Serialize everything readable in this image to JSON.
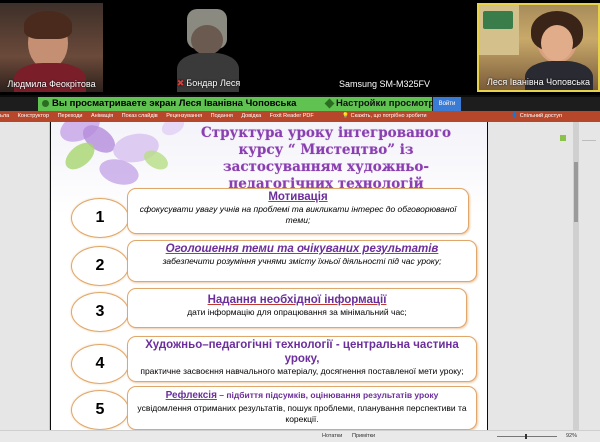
{
  "participants": [
    {
      "name": "Людмила Феокрітова"
    },
    {
      "name": "Бондар Леся",
      "muted": true
    },
    {
      "name": "Samsung SM-M325FV"
    },
    {
      "name": "Леся Іванівна Чоповська"
    }
  ],
  "share": {
    "banner": "Вы просматриваете экран Леся Іванівна Чоповська",
    "settings": "Настройки просмотра",
    "enter_label": "Войти"
  },
  "ribbon": {
    "tabs": [
      "ьла",
      "Конструктор",
      "Переходи",
      "Анімація",
      "Показ слайдів",
      "Рецензування",
      "Подання",
      "Довідка",
      "Foxit Reader PDF"
    ],
    "tell": "Скажіть, що потрібно зробити",
    "share": "Спільний доступ"
  },
  "slide": {
    "title": "Структура уроку інтегрованого курсу  “ Мистецтво” із застосуванням художньо-педагогічних технологій",
    "steps": [
      {
        "num": "1",
        "head": "Мотивація",
        "body": "сфокусувати увагу учнів на проблемі та викликати інтерес до обговорюваної теми;"
      },
      {
        "num": "2",
        "head": "Оголошення теми та очікуваних результатів",
        "body": "забезпечити розуміння учнями змісту їхньої діяльності під час уроку;"
      },
      {
        "num": "3",
        "head": "Надання необхідної інформації",
        "body": "дати інформацію для опрацювання за мінімальний час;"
      },
      {
        "num": "4",
        "head": "Художньо–педагогічні технології - центральна частина уроку,",
        "body": "практичне засвоєння навчального матеріалу, досягнення поставленої мети уроку;"
      },
      {
        "num": "5",
        "head": "Рефлексія",
        "head_extra": " – підбиття підсумків, оцінювання результатів уроку",
        "body": "усвідомлення отриманих результатів, пошук проблеми, планування перспективи та корекції."
      }
    ]
  },
  "status": {
    "notes": "Нотатки",
    "comments": "Примітки",
    "zoom": "92%"
  }
}
